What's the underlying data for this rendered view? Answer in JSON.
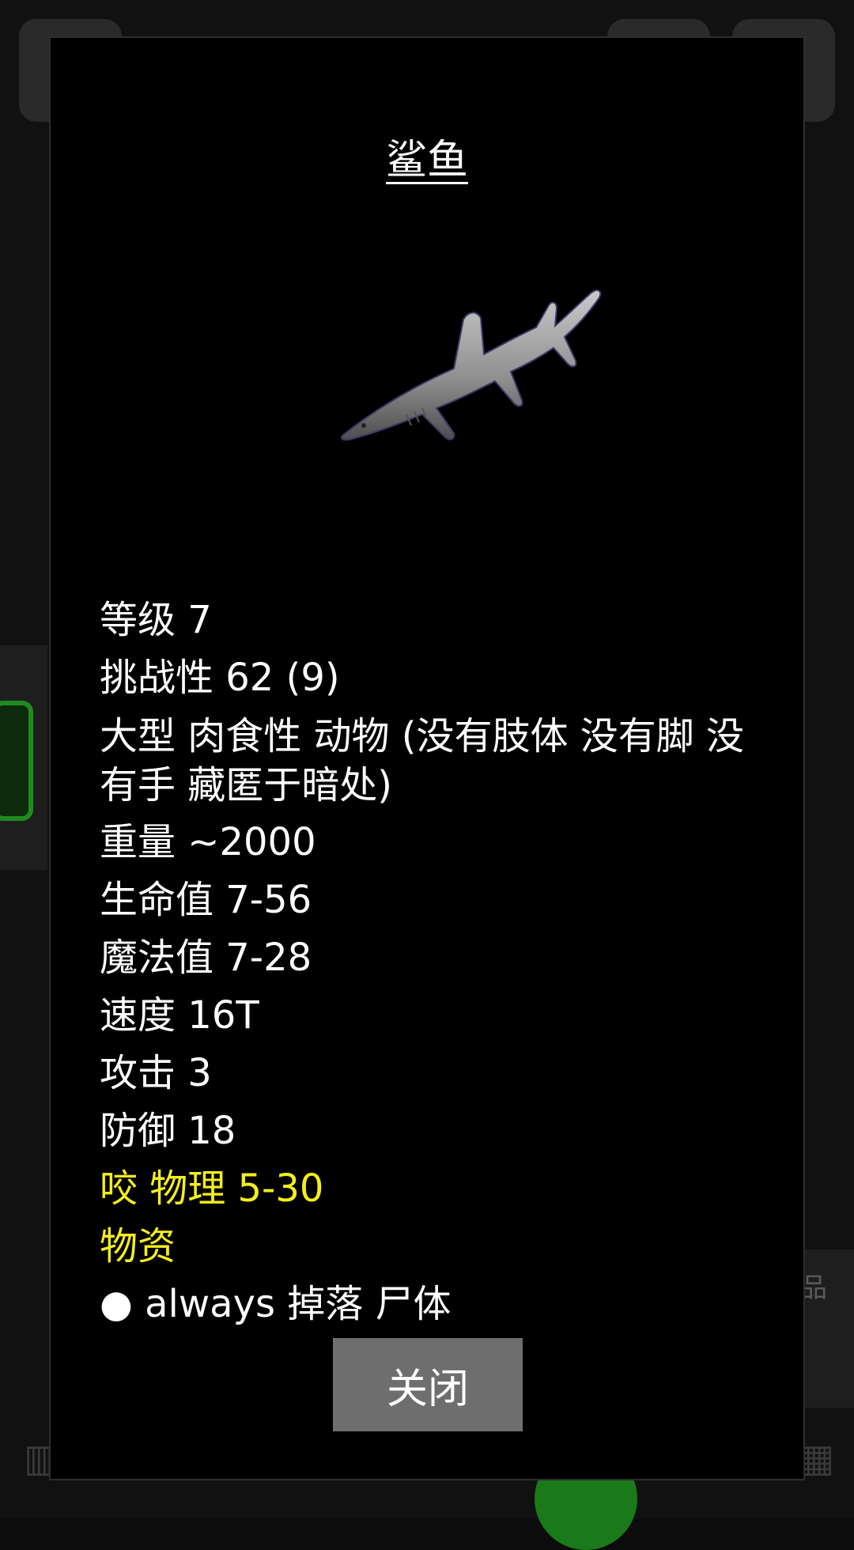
{
  "dialog": {
    "title": "鲨鱼",
    "stats": [
      "等级 7",
      "挑战性 62 (9)",
      "大型 肉食性 动物 (没有肢体 没有脚 没有手 藏匿于暗处)",
      "重量 ~2000",
      "生命值 7-56",
      "魔法值 7-28",
      "速度 16T",
      "攻击 3",
      "防御 18"
    ],
    "attack_line": "咬 物理 5-30",
    "drops_header": "物资",
    "drop_item": "● always 掉落 尸体",
    "close_label": "关闭"
  },
  "background": {
    "partial_label": "品"
  },
  "colors": {
    "highlight": "#f5ef1a",
    "button": "#6e6e6e",
    "modal_bg": "#000000"
  }
}
